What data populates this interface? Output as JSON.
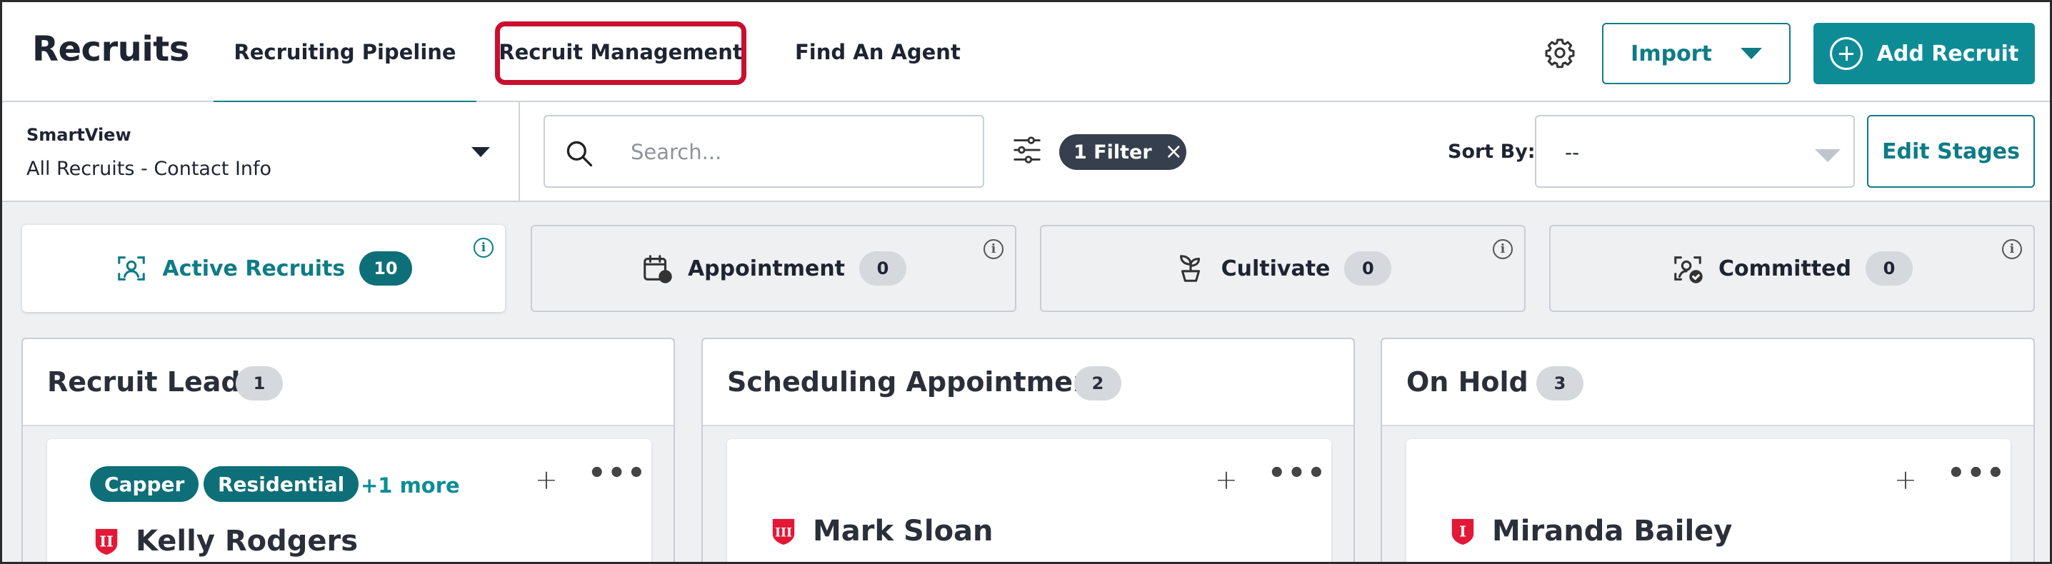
{
  "app": {
    "title": "Recruits"
  },
  "tabs": [
    {
      "label": "Recruiting Pipeline",
      "active": true
    },
    {
      "label": "Recruit Management",
      "highlighted": true
    },
    {
      "label": "Find An Agent"
    }
  ],
  "header_actions": {
    "settings_icon": "gear-icon",
    "import_label": "Import",
    "add_recruit_label": "Add Recruit"
  },
  "toolbar": {
    "smartview_label": "SmartView",
    "smartview_value": "All Recruits - Contact Info",
    "search_placeholder": "Search...",
    "filter_chip": "1 Filter",
    "sort_label": "Sort By:",
    "sort_value": "--",
    "edit_stages_label": "Edit Stages"
  },
  "stats": [
    {
      "label": "Active Recruits",
      "count": "10",
      "icon": "recruit-icon",
      "active": true
    },
    {
      "label": "Appointment",
      "count": "0",
      "icon": "calendar-icon"
    },
    {
      "label": "Cultivate",
      "count": "0",
      "icon": "plant-icon"
    },
    {
      "label": "Committed",
      "count": "0",
      "icon": "committed-icon"
    }
  ],
  "columns": [
    {
      "title": "Recruit Lead",
      "count": "1",
      "card": {
        "tags": [
          "Capper",
          "Residential"
        ],
        "more_tags": "+1 more",
        "name": "Kelly Rodgers",
        "tier": "II"
      }
    },
    {
      "title": "Scheduling Appointment",
      "count": "2",
      "card": {
        "name": "Mark Sloan",
        "tier": "III"
      }
    },
    {
      "title": "On Hold",
      "count": "3",
      "card": {
        "name": "Miranda Bailey",
        "tier": "I"
      }
    }
  ],
  "colors": {
    "accent": "#0e7c86",
    "accent_button": "#0e8c96",
    "highlight": "#c8102e",
    "tier_badge": "#e31837"
  }
}
